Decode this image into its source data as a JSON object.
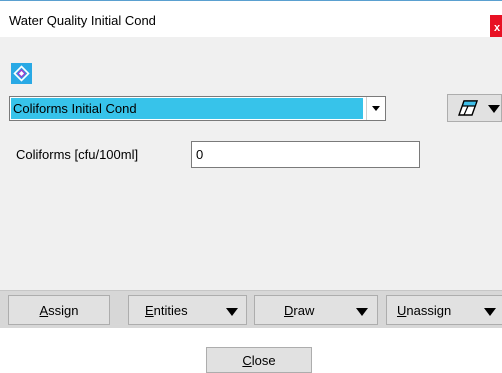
{
  "window": {
    "title": "Water Quality Initial Cond",
    "close_label": "x"
  },
  "condition": {
    "icon": "condition-icon",
    "selected": "Coliforms Initial Cond"
  },
  "fields": [
    {
      "label": "Coliforms [cfu/100ml]",
      "value": "0"
    }
  ],
  "buttons": {
    "assign": {
      "mnemonic": "A",
      "rest": "ssign"
    },
    "entities": {
      "mnemonic": "E",
      "rest": "ntities"
    },
    "draw": {
      "mnemonic": "D",
      "rest": "raw"
    },
    "unassign": {
      "mnemonic": "U",
      "rest": "nassign"
    },
    "close": {
      "mnemonic": "C",
      "rest": "lose"
    }
  },
  "colors": {
    "accent": "#37c3ea",
    "icon_bg": "#29a9e5",
    "close_bg": "#e81123"
  }
}
